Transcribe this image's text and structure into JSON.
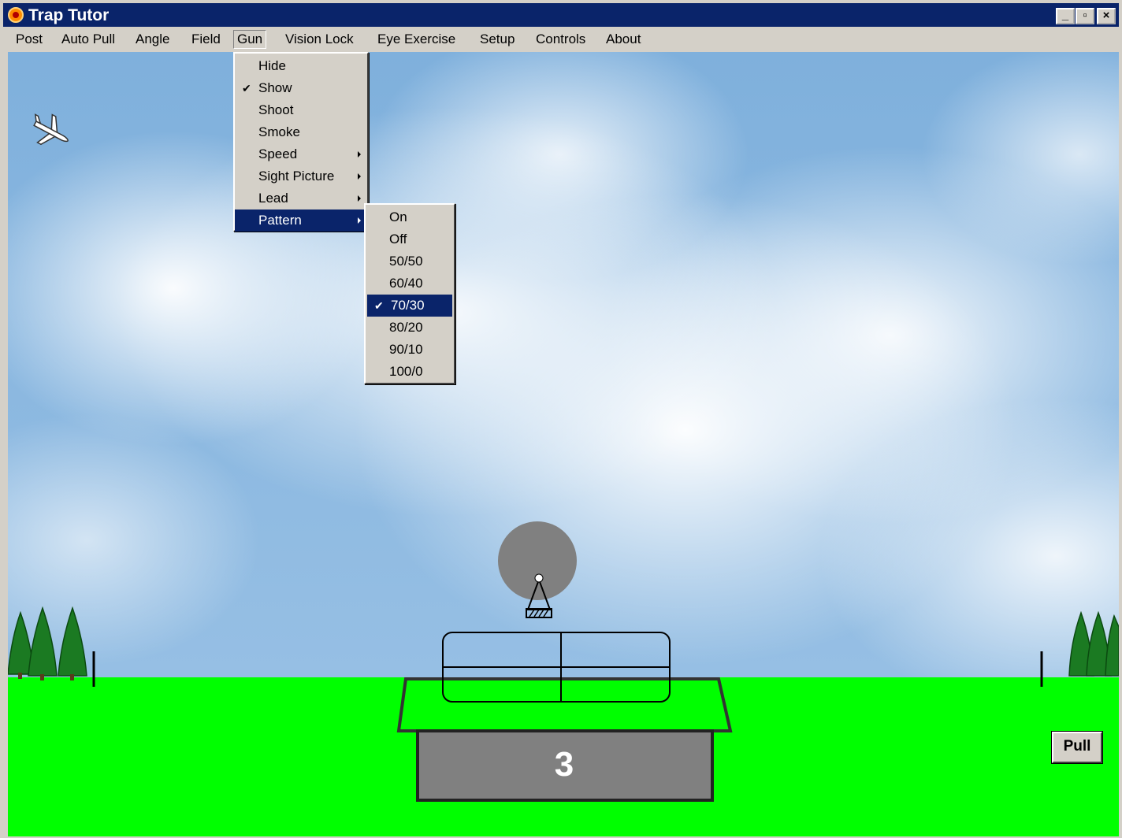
{
  "window": {
    "title": "Trap Tutor",
    "controls": {
      "minimize": "_",
      "restore": "▫",
      "close": "×"
    }
  },
  "menubar": {
    "items": [
      "Post",
      "Auto Pull",
      "Angle",
      "Field",
      "Gun",
      "Vision Lock",
      "Eye Exercise",
      "Setup",
      "Controls",
      "About"
    ],
    "open_item": "Gun"
  },
  "gun_menu": {
    "items": [
      {
        "label": "Hide",
        "checked": false,
        "submenu": false
      },
      {
        "label": "Show",
        "checked": true,
        "submenu": false
      },
      {
        "label": "Shoot",
        "checked": false,
        "submenu": false
      },
      {
        "label": "Smoke",
        "checked": false,
        "submenu": false
      },
      {
        "label": "Speed",
        "checked": false,
        "submenu": true
      },
      {
        "label": "Sight Picture",
        "checked": false,
        "submenu": true
      },
      {
        "label": "Lead",
        "checked": false,
        "submenu": true
      },
      {
        "label": "Pattern",
        "checked": false,
        "submenu": true,
        "highlighted": true
      }
    ]
  },
  "pattern_menu": {
    "items": [
      {
        "label": "On",
        "checked": false
      },
      {
        "label": "Off",
        "checked": false
      },
      {
        "label": "50/50",
        "checked": false
      },
      {
        "label": "60/40",
        "checked": false
      },
      {
        "label": "70/30",
        "checked": true,
        "highlighted": true
      },
      {
        "label": "80/20",
        "checked": false
      },
      {
        "label": "90/10",
        "checked": false
      },
      {
        "label": "100/0",
        "checked": false
      }
    ]
  },
  "scene": {
    "trap_house_number": "3",
    "pull_button": "Pull",
    "check_glyph": "✔",
    "icons": [
      "airplane-icon",
      "tree-icon",
      "clay-target-icon"
    ]
  },
  "colors": {
    "titlebar": "#0a246a",
    "menu_highlight": "#0a246a",
    "ground": "#00ff00",
    "trap_house": "#808080",
    "sky": "#7fb0dc"
  }
}
